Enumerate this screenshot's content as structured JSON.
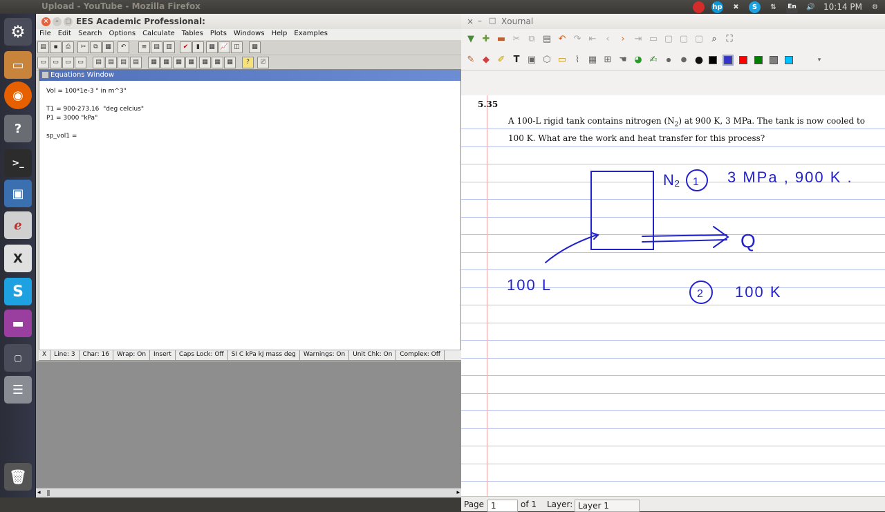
{
  "topbar": {
    "window_title": "Upload - YouTube - Mozilla Firefox",
    "keyboard": "En",
    "clock": "10:14 PM"
  },
  "ees": {
    "title": "EES Academic Professional:",
    "menu": [
      "File",
      "Edit",
      "Search",
      "Options",
      "Calculate",
      "Tables",
      "Plots",
      "Windows",
      "Help",
      "Examples"
    ],
    "equations_window": {
      "title": "Equations Window",
      "lines": [
        "Vol = 100*1e-3 \" in m^3\"",
        "",
        "T1 = 900-273.16  \"deg celcius\"",
        "P1 = 3000 \"kPa\"",
        "",
        "sp_vol1 ="
      ]
    },
    "status": [
      "X",
      "Line: 3",
      "Char: 16",
      "Wrap: On",
      "Insert",
      "Caps Lock: Off",
      "SI C kPa kJ mass deg",
      "Warnings: On",
      "Unit Chk: On",
      "Complex: Off"
    ]
  },
  "xournal": {
    "title": "Xournal",
    "problem_number": "5.35",
    "problem_text_a": "A 100-L rigid tank contains nitrogen (N",
    "problem_sub": "2",
    "problem_text_b": ") at 900 K, 3 MPa. The tank is now cooled to 100 K. What are the work and heat transfer for this process?",
    "handwriting": {
      "n2": "N₂",
      "state1_num": "1",
      "state1": "3 MPa , 900 K .",
      "q": "Q",
      "volume": "100 L",
      "state2_num": "2",
      "state2": "100 K"
    },
    "status": {
      "page_label": "Page",
      "page_value": "1",
      "of": "of 1",
      "layer_label": "Layer:",
      "layer_value": "Layer 1"
    },
    "pen_colors": [
      "#000000",
      "#3333cc",
      "#ff0000",
      "#008000",
      "#808080",
      "#00c0ff"
    ]
  }
}
